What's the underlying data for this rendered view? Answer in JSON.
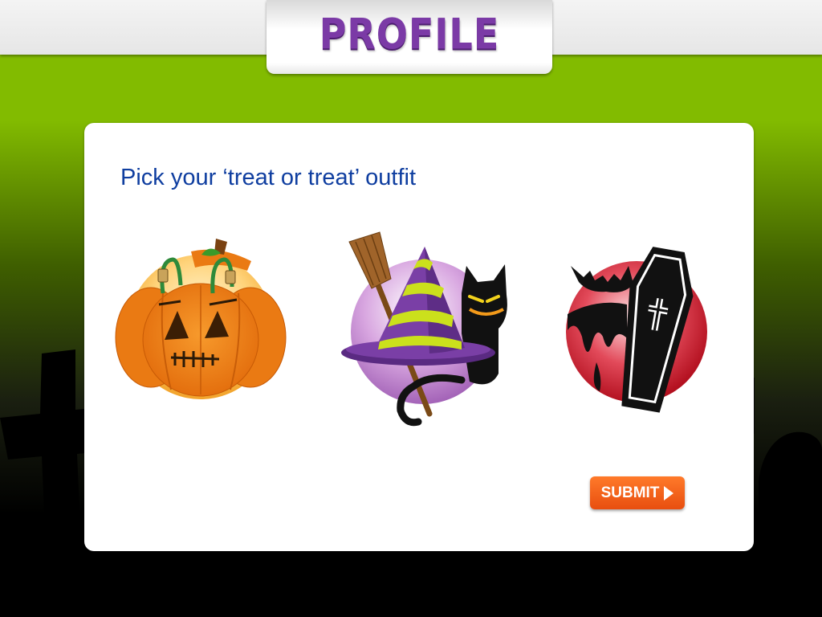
{
  "header": {
    "title": "PROFILE",
    "title_color": "#7b3aa6"
  },
  "background": {
    "top_color": "#82bb00",
    "bottom_color": "#000000"
  },
  "card": {
    "prompt": "Pick your ‘treat or treat’ outfit",
    "prompt_color": "#0f3ea0",
    "options": [
      {
        "id": "pumpkin",
        "icon": "pumpkin-icon"
      },
      {
        "id": "witch",
        "icon": "witch-hat-cat-broom-icon"
      },
      {
        "id": "vampire",
        "icon": "coffin-bat-icon"
      }
    ],
    "submit_label": "SUBMIT",
    "submit_icon": "play-arrow-icon",
    "submit_color": "#f26419"
  }
}
